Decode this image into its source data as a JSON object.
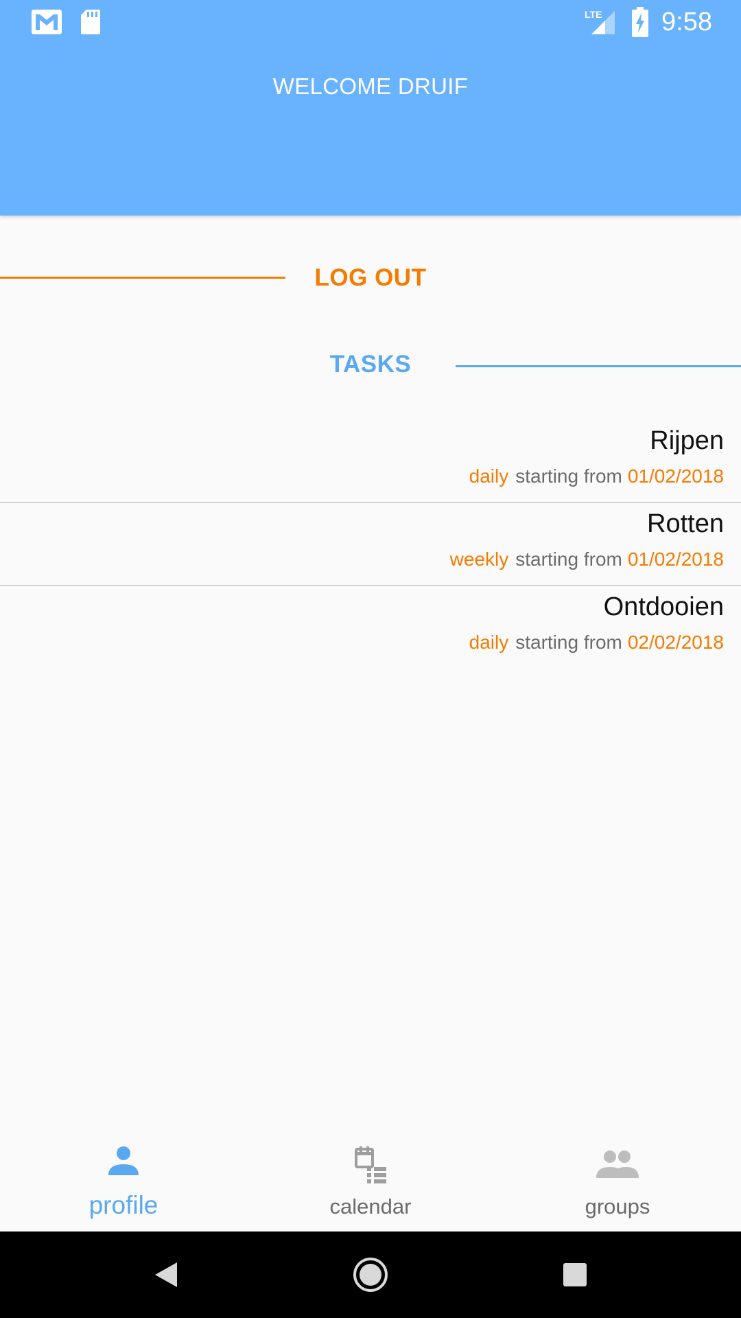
{
  "status_bar": {
    "time": "9:58",
    "network_label": "LTE",
    "icons": [
      "gmail-icon",
      "sd-card-icon",
      "lte-signal-icon",
      "battery-charging-icon"
    ]
  },
  "header": {
    "title": "WELCOME DRUIF",
    "color": "#68b2fe"
  },
  "actions": {
    "logout_label": "LOG OUT",
    "tasks_label": "TASKS",
    "accent_orange": "#f57c00",
    "accent_blue": "#5aa9f0"
  },
  "tasks": [
    {
      "name": "Rijpen",
      "frequency": "daily",
      "starting_text": "starting from",
      "date": "01/02/2018"
    },
    {
      "name": "Rotten",
      "frequency": "weekly",
      "starting_text": "starting from",
      "date": "01/02/2018"
    },
    {
      "name": "Ontdooien",
      "frequency": "daily",
      "starting_text": "starting from",
      "date": "02/02/2018"
    }
  ],
  "bottom_nav": {
    "items": [
      {
        "label": "profile",
        "icon": "person-icon",
        "active": true
      },
      {
        "label": "calendar",
        "icon": "calendar-list-icon",
        "active": false
      },
      {
        "label": "groups",
        "icon": "group-icon",
        "active": false
      }
    ]
  },
  "system_nav": {
    "icons": [
      "back-icon",
      "home-icon",
      "recents-icon"
    ]
  }
}
